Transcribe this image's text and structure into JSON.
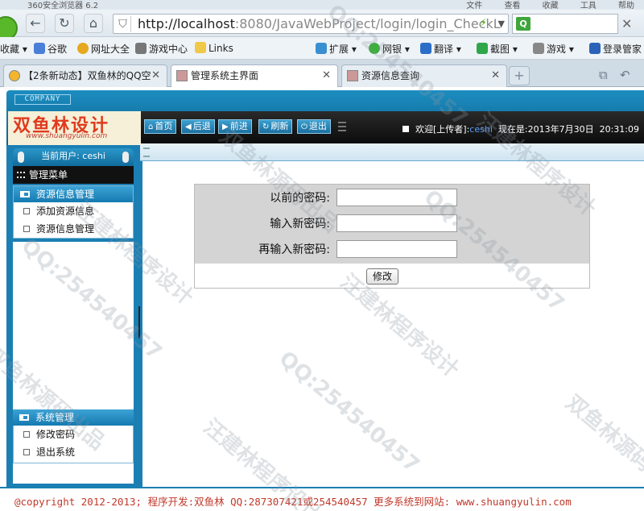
{
  "browser": {
    "window_title": "360安全浏览器 6.2",
    "menu_items": [
      "文件",
      "查看",
      "收藏",
      "工具",
      "帮助"
    ],
    "url_host": "http://localhost",
    "url_rest": ":8080/JavaWebProject/login/login_CheckL",
    "bookmarks": [
      "收藏",
      "谷歌",
      "网址大全",
      "游戏中心",
      "Links",
      "扩展",
      "网银",
      "翻译",
      "截图",
      "游戏",
      "登录管家"
    ],
    "tabs": [
      {
        "label": "【2条新动态】双鱼林的QQ空",
        "active": false
      },
      {
        "label": "管理系统主界面",
        "active": true
      },
      {
        "label": "资源信息查询",
        "active": false
      }
    ]
  },
  "header": {
    "company_tag": "COMPANY",
    "logo_name": "双鱼林设计",
    "logo_site": "www.shuangyulin.com",
    "toolbar_buttons": [
      "首页",
      "后退",
      "前进",
      "刷新",
      "退出"
    ],
    "welcome_prefix": "欢迎[上传者]:",
    "welcome_user": "ceshi",
    "now_label": "现在是:",
    "date": "2013年7月30日",
    "time": "20:31:09"
  },
  "sidebar": {
    "current_user": "当前用户: ceshi",
    "menu_title": "管理菜单",
    "group1": {
      "title": "资源信息管理",
      "items": [
        "添加资源信息",
        "资源信息管理"
      ]
    },
    "group2": {
      "title": "系统管理",
      "items": [
        "修改密码",
        "退出系统"
      ]
    }
  },
  "form": {
    "old_password_label": "以前的密码:",
    "new_password_label": "输入新密码:",
    "confirm_password_label": "再输入新密码:",
    "old_password_value": "",
    "new_password_value": "",
    "confirm_password_value": "",
    "submit_label": "修改"
  },
  "footer": {
    "text": "@copyright 2012-2013; 程序开发:双鱼林  QQ:287307421或254540457  更多系统到网站: www.shuangyulin.com"
  },
  "watermarks": [
    "双鱼林源码出品",
    "QQ:254540457",
    "汪建林程序设计"
  ],
  "colors": {
    "header_blue": "#1b7fb4",
    "toolbar_black": "#111111",
    "footer_red": "#c0392b"
  }
}
